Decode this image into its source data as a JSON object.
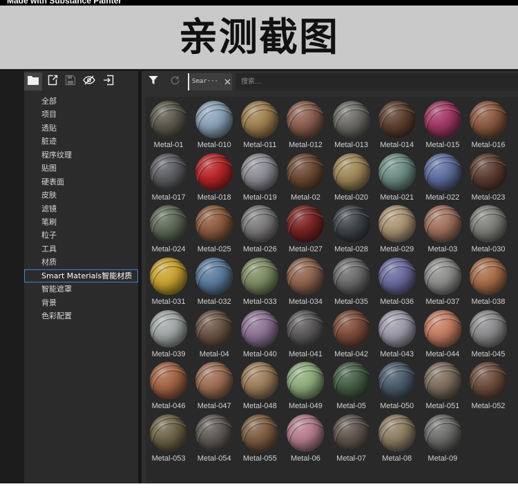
{
  "watermark": "Made with Substance Painter",
  "banner": {
    "title": "亲测截图"
  },
  "theme": {
    "selection_border": "#3a86dc",
    "chip_edge": "#e6e6e6"
  },
  "sidebar": {
    "toolbar_icons": [
      "folder-icon",
      "new-file-icon",
      "save-icon",
      "eye-slash-icon",
      "import-icon"
    ],
    "active_tool": "folder-icon",
    "items": [
      {
        "label": "全部"
      },
      {
        "label": "项目"
      },
      {
        "label": "透贴"
      },
      {
        "label": "脏迹"
      },
      {
        "label": "程序纹理"
      },
      {
        "label": "贴图"
      },
      {
        "label": "硬表面"
      },
      {
        "label": "皮肤"
      },
      {
        "label": "滤镜"
      },
      {
        "label": "笔刷"
      },
      {
        "label": "粒子"
      },
      {
        "label": "工具"
      },
      {
        "label": "材质"
      },
      {
        "label": "Smart Materials智能材质",
        "selected": true
      },
      {
        "label": "智能遮罩"
      },
      {
        "label": "背景"
      },
      {
        "label": "色彩配置"
      }
    ]
  },
  "toolbar": {
    "filter_icon": "filter-icon",
    "refresh_icon": "refresh-icon",
    "filter_chip": {
      "label": "Smar···",
      "close_icon": "close-icon"
    },
    "search": {
      "placeholder": "搜索..."
    }
  },
  "materials": [
    {
      "name": "Metal-01",
      "color": "#5c5a4e"
    },
    {
      "name": "Metal-010",
      "color": "#8aa2b8"
    },
    {
      "name": "Metal-011",
      "color": "#a08050"
    },
    {
      "name": "Metal-012",
      "color": "#8c5f4f"
    },
    {
      "name": "Metal-013",
      "color": "#6e6c66"
    },
    {
      "name": "Metal-014",
      "color": "#5e4030"
    },
    {
      "name": "Metal-015",
      "color": "#a13866"
    },
    {
      "name": "Metal-016",
      "color": "#8d5a40"
    },
    {
      "name": "Metal-017",
      "color": "#5c5e62"
    },
    {
      "name": "Metal-018",
      "color": "#b82428"
    },
    {
      "name": "Metal-019",
      "color": "#8e8e96"
    },
    {
      "name": "Metal-02",
      "color": "#6e4a34"
    },
    {
      "name": "Metal-020",
      "color": "#a08858"
    },
    {
      "name": "Metal-021",
      "color": "#6f8f86"
    },
    {
      "name": "Metal-022",
      "color": "#5f6fa0"
    },
    {
      "name": "Metal-023",
      "color": "#5e3e32"
    },
    {
      "name": "Metal-024",
      "color": "#5e6a56"
    },
    {
      "name": "Metal-025",
      "color": "#8e5c40"
    },
    {
      "name": "Metal-026",
      "color": "#7c7a7a"
    },
    {
      "name": "Metal-027",
      "color": "#7c2424"
    },
    {
      "name": "Metal-028",
      "color": "#3e4448"
    },
    {
      "name": "Metal-029",
      "color": "#ac9474"
    },
    {
      "name": "Metal-03",
      "color": "#a0705e"
    },
    {
      "name": "Metal-030",
      "color": "#80807a"
    },
    {
      "name": "Metal-031",
      "color": "#c9a230"
    },
    {
      "name": "Metal-032",
      "color": "#5c7c9e"
    },
    {
      "name": "Metal-033",
      "color": "#7e8e64"
    },
    {
      "name": "Metal-034",
      "color": "#906450"
    },
    {
      "name": "Metal-035",
      "color": "#6c6c6c"
    },
    {
      "name": "Metal-036",
      "color": "#6c6ca0"
    },
    {
      "name": "Metal-037",
      "color": "#8e8e8c"
    },
    {
      "name": "Metal-038",
      "color": "#a86e4a"
    },
    {
      "name": "Metal-039",
      "color": "#a0a6a6"
    },
    {
      "name": "Metal-04",
      "color": "#6c5444"
    },
    {
      "name": "Metal-040",
      "color": "#8e7496"
    },
    {
      "name": "Metal-041",
      "color": "#5c5a5a"
    },
    {
      "name": "Metal-042",
      "color": "#7e4c3a"
    },
    {
      "name": "Metal-043",
      "color": "#9e9cac"
    },
    {
      "name": "Metal-044",
      "color": "#c47c62"
    },
    {
      "name": "Metal-045",
      "color": "#8c8c8e"
    },
    {
      "name": "Metal-046",
      "color": "#a46444"
    },
    {
      "name": "Metal-047",
      "color": "#9e6e54"
    },
    {
      "name": "Metal-048",
      "color": "#9e7e5c"
    },
    {
      "name": "Metal-049",
      "color": "#8eac7c"
    },
    {
      "name": "Metal-05",
      "color": "#445e44"
    },
    {
      "name": "Metal-050",
      "color": "#4c5c6c"
    },
    {
      "name": "Metal-051",
      "color": "#7e6e5e"
    },
    {
      "name": "Metal-052",
      "color": "#6e4e3e"
    },
    {
      "name": "Metal-053",
      "color": "#6e6448"
    },
    {
      "name": "Metal-054",
      "color": "#5e5a54"
    },
    {
      "name": "Metal-055",
      "color": "#7e5e42"
    },
    {
      "name": "Metal-06",
      "color": "#b47c8c"
    },
    {
      "name": "Metal-07",
      "color": "#5e544c"
    },
    {
      "name": "Metal-08",
      "color": "#8e7e64"
    },
    {
      "name": "Metal-09",
      "color": "#6e6e6c"
    }
  ]
}
